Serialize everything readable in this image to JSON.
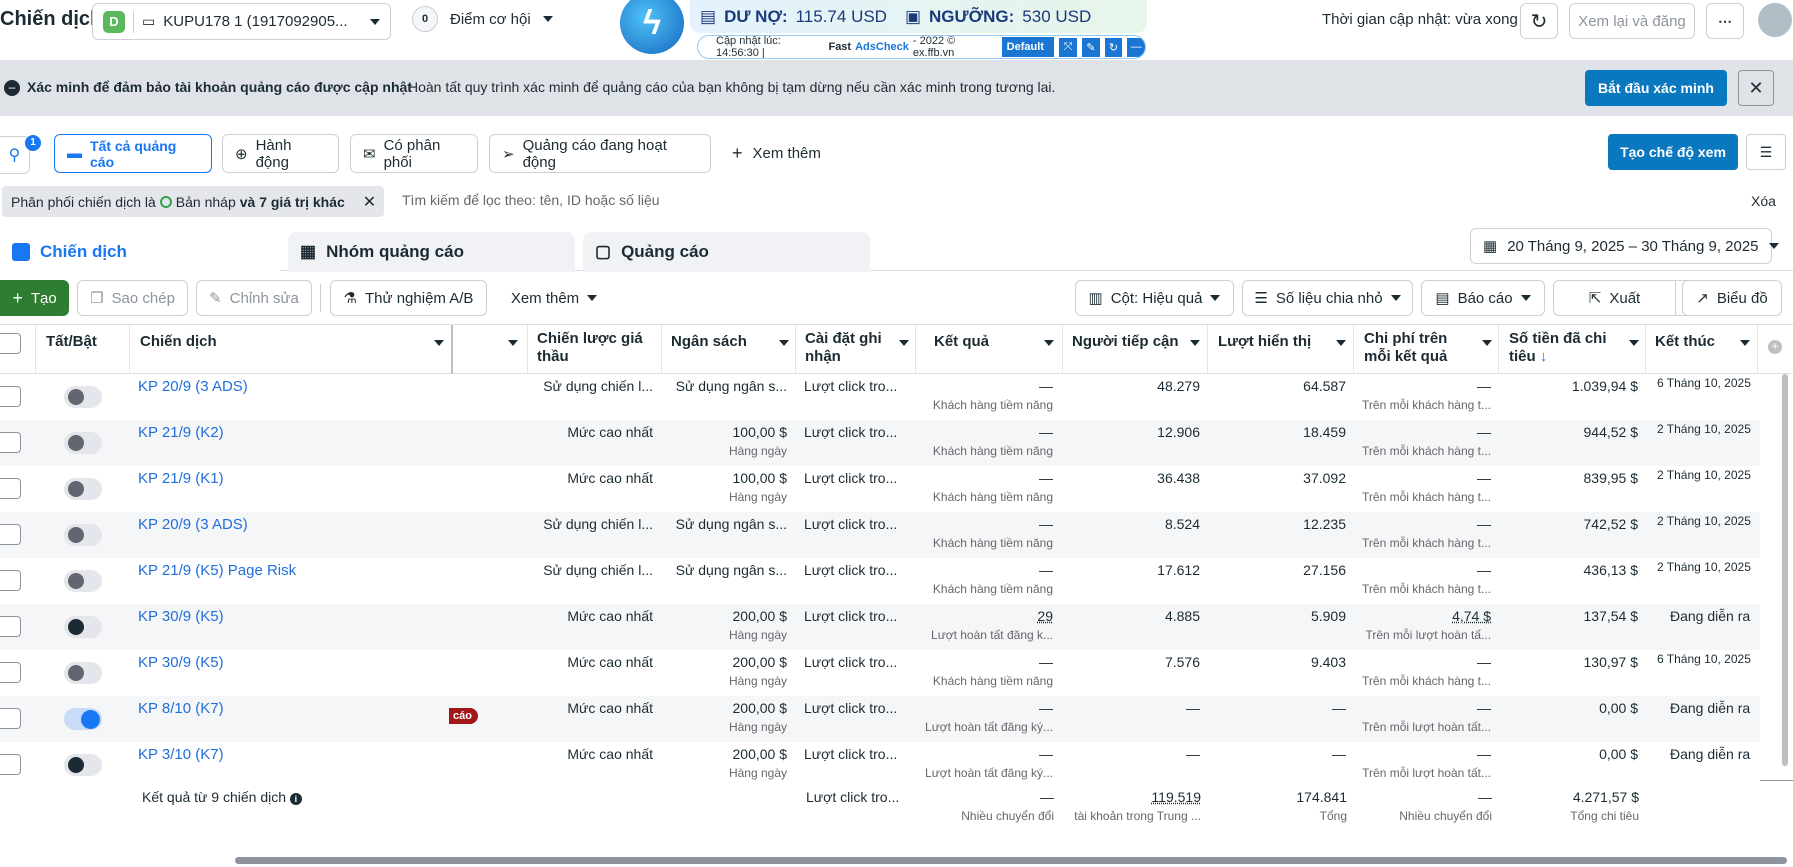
{
  "header": {
    "title": "Chiến dịch",
    "account_letter": "D",
    "account_name": "KUPU178 1 (1917092905...",
    "score_value": "0",
    "score_label": "Điểm cơ hội",
    "updated_text": "Thời gian cập nhật: vừa xong",
    "review_button": "Xem lại và đăng"
  },
  "plugin": {
    "debt_label": "DƯ NỢ:",
    "debt_value": "115.74 USD",
    "threshold_label": "NGƯỠNG:",
    "threshold_value": "530 USD",
    "updated_prefix": "Cập nhật lúc: 14:56:30 |",
    "brand_fast": "Fast",
    "brand_ads": "AdsCheck",
    "brand_suffix": "- 2022 © ex.ffb.vn",
    "default_label": "Default"
  },
  "banner": {
    "title": "Xác minh để đảm bảo tài khoản quảng cáo được cập nhật",
    "text": "Hoàn tất quy trình xác minh để quảng cáo của bạn không bị tạm dừng nếu cần xác minh trong tương lai.",
    "button": "Bắt đầu xác minh"
  },
  "view_tabs": {
    "search_badge": "1",
    "all_ads": "Tất cả quảng cáo",
    "actions": "Hành động",
    "delivery": "Có phân phối",
    "active_ads": "Quảng cáo đang hoạt động",
    "more": "Xem thêm",
    "create_view": "Tạo chế độ xem"
  },
  "filter": {
    "chip_prefix": "Phân phối chiến dịch là",
    "chip_value": "Bản nháp",
    "chip_suffix": "và 7 giá trị khác",
    "placeholder": "Tìm kiếm để lọc theo: tên, ID hoặc số liệu",
    "clear": "Xóa"
  },
  "level_tabs": {
    "campaigns": "Chiến dịch",
    "adsets": "Nhóm quảng cáo",
    "ads": "Quảng cáo"
  },
  "date_range": "20 Tháng 9, 2025 – 30 Tháng 9, 2025",
  "toolbar": {
    "create": "Tạo",
    "duplicate": "Sao chép",
    "edit": "Chỉnh sửa",
    "ab_test": "Thử nghiệm A/B",
    "more": "Xem thêm",
    "columns": "Cột: Hiệu quả",
    "breakdown": "Số liệu chia nhỏ",
    "reports": "Báo cáo",
    "export": "Xuất",
    "charts": "Biểu đồ"
  },
  "table": {
    "headers": {
      "toggle": "Tất/Bật",
      "campaign": "Chiến dịch",
      "bid": "Chiến lược giá thầu",
      "budget": "Ngân sách",
      "attribution": "Cài đặt ghi nhận",
      "results": "Kết quả",
      "reach": "Người tiếp cận",
      "impressions": "Lượt hiển thị",
      "cpr": "Chi phí trên mỗi kết quả",
      "spent": "Số tiền đã chi tiêu",
      "end": "Kết thúc"
    },
    "rows": [
      {
        "name": "KP 20/9 (3 ADS)",
        "toggle": "off",
        "bid": "Sử dụng chiến l...",
        "budget": "Sử dụng ngân s...",
        "budget_sub": "",
        "attr": "Lượt click tro...",
        "result": "—",
        "result_sub": "Khách hàng tiềm năng",
        "reach": "48.279",
        "impr": "64.587",
        "cpr": "—",
        "cpr_sub": "Trên mỗi khách hàng t...",
        "spent": "1.039,94 $",
        "end": "6 Tháng 10, 2025"
      },
      {
        "name": "KP 21/9 (K2)",
        "toggle": "off",
        "bid": "Mức cao nhất",
        "budget": "100,00 $",
        "budget_sub": "Hàng ngày",
        "attr": "Lượt click tro...",
        "result": "—",
        "result_sub": "Khách hàng tiềm năng",
        "reach": "12.906",
        "impr": "18.459",
        "cpr": "—",
        "cpr_sub": "Trên mỗi khách hàng t...",
        "spent": "944,52 $",
        "end": "2 Tháng 10, 2025"
      },
      {
        "name": "KP 21/9 (K1)",
        "toggle": "off",
        "bid": "Mức cao nhất",
        "budget": "100,00 $",
        "budget_sub": "Hàng ngày",
        "attr": "Lượt click tro...",
        "result": "—",
        "result_sub": "Khách hàng tiềm năng",
        "reach": "36.438",
        "impr": "37.092",
        "cpr": "—",
        "cpr_sub": "Trên mỗi khách hàng t...",
        "spent": "839,95 $",
        "end": "2 Tháng 10, 2025"
      },
      {
        "name": "KP 20/9 (3 ADS)",
        "toggle": "off",
        "bid": "Sử dụng chiến l...",
        "budget": "Sử dụng ngân s...",
        "budget_sub": "",
        "attr": "Lượt click tro...",
        "result": "—",
        "result_sub": "Khách hàng tiềm năng",
        "reach": "8.524",
        "impr": "12.235",
        "cpr": "—",
        "cpr_sub": "Trên mỗi khách hàng t...",
        "spent": "742,52 $",
        "end": "2 Tháng 10, 2025"
      },
      {
        "name": "KP 21/9 (K5) Page Risk",
        "toggle": "off",
        "bid": "Sử dụng chiến l...",
        "budget": "Sử dụng ngân s...",
        "budget_sub": "",
        "attr": "Lượt click tro...",
        "result": "—",
        "result_sub": "Khách hàng tiềm năng",
        "reach": "17.612",
        "impr": "27.156",
        "cpr": "—",
        "cpr_sub": "Trên mỗi khách hàng t...",
        "spent": "436,13 $",
        "end": "2 Tháng 10, 2025"
      },
      {
        "name": "KP 30/9 (K5)",
        "toggle": "dark",
        "bid": "Mức cao nhất",
        "budget": "200,00 $",
        "budget_sub": "Hàng ngày",
        "attr": "Lượt click tro...",
        "result": "29",
        "result_sub": "Lượt hoàn tất đăng k...",
        "reach": "4.885",
        "impr": "5.909",
        "cpr": "4,74 $",
        "cpr_sub": "Trên mỗi lượt hoàn tấ...",
        "spent": "137,54 $",
        "end": "Đang diễn ra"
      },
      {
        "name": "KP 30/9 (K5)",
        "toggle": "off",
        "bid": "Mức cao nhất",
        "budget": "200,00 $",
        "budget_sub": "Hàng ngày",
        "attr": "Lượt click tro...",
        "result": "—",
        "result_sub": "Khách hàng tiềm năng",
        "reach": "7.576",
        "impr": "9.403",
        "cpr": "—",
        "cpr_sub": "Trên mỗi khách hàng t...",
        "spent": "130,97 $",
        "end": "6 Tháng 10, 2025"
      },
      {
        "name": "KP 8/10 (K7)",
        "toggle": "on",
        "bid": "Mức cao nhất",
        "budget": "200,00 $",
        "budget_sub": "Hàng ngày",
        "attr": "Lượt click tro...",
        "result": "—",
        "result_sub": "Lượt hoàn tất đăng ký...",
        "reach": "—",
        "impr": "—",
        "cpr": "—",
        "cpr_sub": "Trên mỗi lượt hoàn tất...",
        "spent": "0,00 $",
        "end": "Đang diễn ra",
        "badge": "cáo"
      },
      {
        "name": "KP 3/10 (K7)",
        "toggle": "dark",
        "bid": "Mức cao nhất",
        "budget": "200,00 $",
        "budget_sub": "Hàng ngày",
        "attr": "Lượt click tro...",
        "result": "—",
        "result_sub": "Lượt hoàn tất đăng ký...",
        "reach": "—",
        "impr": "—",
        "cpr": "—",
        "cpr_sub": "Trên mỗi lượt hoàn tất...",
        "spent": "0,00 $",
        "end": "Đang diễn ra"
      }
    ],
    "summary": {
      "label": "Kết quả từ 9 chiến dịch",
      "attr": "Lượt click tro...",
      "result": "—",
      "result_sub": "Nhiều chuyển đổi",
      "reach": "119.519",
      "reach_sub": "tài khoản trong Trung ...",
      "impr": "174.841",
      "impr_sub": "Tổng",
      "cpr": "—",
      "cpr_sub": "Nhiều chuyển đổi",
      "spent": "4.271,57 $",
      "spent_sub": "Tổng chi tiêu"
    }
  }
}
